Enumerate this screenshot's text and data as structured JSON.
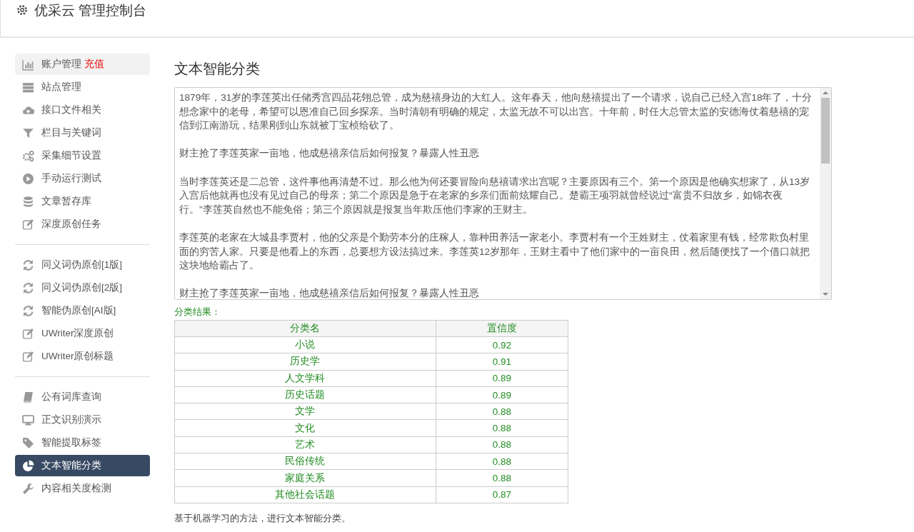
{
  "header": {
    "title": "优采云 管理控制台"
  },
  "sidebar": {
    "groups": [
      {
        "items": [
          {
            "label": "账户管理",
            "badge": "充值",
            "highlighted": true,
            "selected": false
          },
          {
            "label": "站点管理",
            "highlighted": false,
            "selected": false
          },
          {
            "label": "接口文件相关",
            "highlighted": false,
            "selected": false
          },
          {
            "label": "栏目与关键词",
            "highlighted": false,
            "selected": false
          },
          {
            "label": "采集细节设置",
            "highlighted": false,
            "selected": false
          },
          {
            "label": "手动运行测试",
            "highlighted": false,
            "selected": false
          },
          {
            "label": "文章暂存库",
            "highlighted": false,
            "selected": false
          },
          {
            "label": "深度原创任务",
            "highlighted": false,
            "selected": false
          }
        ]
      },
      {
        "items": [
          {
            "label": "同义词伪原创[1版]",
            "highlighted": false,
            "selected": false
          },
          {
            "label": "同义词伪原创[2版]",
            "highlighted": false,
            "selected": false
          },
          {
            "label": "智能伪原创[AI版]",
            "highlighted": false,
            "selected": false
          },
          {
            "label": "UWriter深度原创",
            "highlighted": false,
            "selected": false
          },
          {
            "label": "UWriter原创标题",
            "highlighted": false,
            "selected": false
          }
        ]
      },
      {
        "items": [
          {
            "label": "公有词库查询",
            "highlighted": false,
            "selected": false
          },
          {
            "label": "正文识别演示",
            "highlighted": false,
            "selected": false
          },
          {
            "label": "智能提取标签",
            "highlighted": false,
            "selected": false
          },
          {
            "label": "文本智能分类",
            "highlighted": false,
            "selected": true
          },
          {
            "label": "内容相关度检测",
            "highlighted": false,
            "selected": false
          }
        ]
      }
    ]
  },
  "main": {
    "title": "文本智能分类",
    "input_text": {
      "paragraphs": [
        "1879年，31岁的李莲英出任储秀宫四品花翎总管，成为慈禧身边的大红人。这年春天，他向慈禧提出了一个请求，说自己已经入宫18年了，十分想念家中的老母，希望可以恩准自己回乡探亲。当时清朝有明确的规定，太监无故不可以出宫。十年前，时任大总管太监的安德海仗着慈禧的宠信到江南游玩，结果刚到山东就被丁宝桢给砍了。",
        "财主抢了李莲英家一亩地，他成慈禧亲信后如何报复？暴露人性丑恶",
        "当时李莲英还是二总管，这件事他再清楚不过。那么他为何还要冒险向慈禧请求出宫呢？主要原因有三个。第一个原因是他确实想家了，从13岁入宫后他就再也没有见过自己的母亲；第二个原因是急于在老家的乡亲们面前炫耀自己。楚霸王项羽就曾经说过“富贵不归故乡，如锦衣夜行。”李莲英自然也不能免俗；第三个原因就是报复当年欺压他们李家的王财主。",
        "李莲英的老家在大城县李贾村，他的父亲是个勤劳本分的庄稼人，靠种田养活一家老小。李贾村有一个王姓财主，仗着家里有钱，经常欺负村里面的穷苦人家。只要是他看上的东西，总要想方设法搞过来。李莲英12岁那年，王财主看中了他们家中的一亩良田，然后随便找了一个借口就把这块地给霸占了。",
        "财主抢了李莲英家一亩地，他成慈禧亲信后如何报复？暴露人性丑恶"
      ]
    },
    "result_label": "分类结果：",
    "table": {
      "columns": [
        "分类名",
        "置信度"
      ],
      "rows": [
        [
          "小说",
          "0.92"
        ],
        [
          "历史学",
          "0.91"
        ],
        [
          "人文学科",
          "0.89"
        ],
        [
          "历史话题",
          "0.89"
        ],
        [
          "文学",
          "0.88"
        ],
        [
          "文化",
          "0.88"
        ],
        [
          "艺术",
          "0.88"
        ],
        [
          "民俗传统",
          "0.88"
        ],
        [
          "家庭关系",
          "0.88"
        ],
        [
          "其他社会话题",
          "0.87"
        ]
      ]
    },
    "footnote": "基于机器学习的方法，进行文本智能分类。"
  }
}
